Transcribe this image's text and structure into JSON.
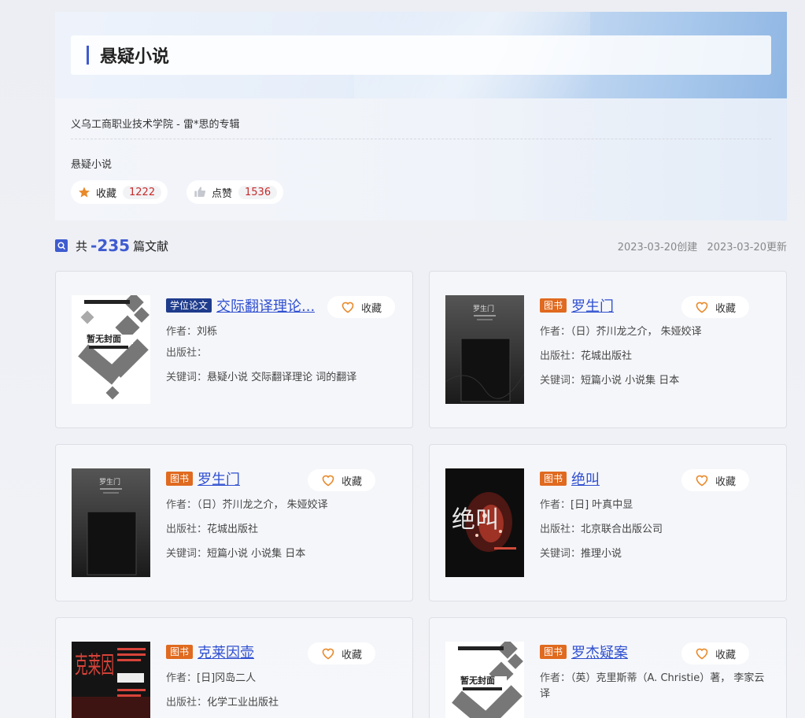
{
  "header": {
    "title": "悬疑小说",
    "meta": "义乌工商职业技术学院 - 雷*思的专辑",
    "description": "悬疑小说",
    "favorites_label": "收藏",
    "favorites_count": "1222",
    "likes_label": "点赞",
    "likes_count": "1536"
  },
  "summary": {
    "prefix": "共",
    "count": "-235",
    "suffix": "篇文献",
    "created": "2023-03-20创建",
    "updated": "2023-03-20更新"
  },
  "labels": {
    "author": "作者：",
    "publisher": "出版社：",
    "keywords": "关键词：",
    "favorite": "收藏"
  },
  "cards": [
    {
      "tag": "学位论文",
      "title": "交际翻译理论...",
      "author": "刘栎",
      "publisher": "",
      "keywords": "悬疑小说 交际翻译理论 词的翻译",
      "cover": "暂无封面"
    },
    {
      "tag": "图书",
      "title": "罗生门",
      "author": "（日）芥川龙之介， 朱娅姣译",
      "publisher": "花城出版社",
      "keywords": "短篇小说 小说集 日本",
      "cover": "罗生门"
    },
    {
      "tag": "图书",
      "title": "罗生门",
      "author": "（日）芥川龙之介， 朱娅姣译",
      "publisher": "花城出版社",
      "keywords": "短篇小说 小说集 日本",
      "cover": "罗生门"
    },
    {
      "tag": "图书",
      "title": "绝叫",
      "author": "[日] 叶真中显",
      "publisher": "北京联合出版公司",
      "keywords": "推理小说",
      "cover": "绝叫"
    },
    {
      "tag": "图书",
      "title": "克莱因壶",
      "author": "[日]冈岛二人",
      "publisher": "化学工业出版社",
      "keywords": "",
      "cover": "克莱因"
    },
    {
      "tag": "图书",
      "title": "罗杰疑案",
      "author": "（英）克里斯蒂（A. Christie）著， 李家云译",
      "publisher": "",
      "keywords": "",
      "cover": "暂无封面"
    }
  ],
  "colors": {
    "accent": "#3e5bd0",
    "thesis_tag": "#1f3c8c",
    "book_tag": "#e06a1f",
    "count_red": "#c72a2a",
    "heart": "#e8892a"
  }
}
